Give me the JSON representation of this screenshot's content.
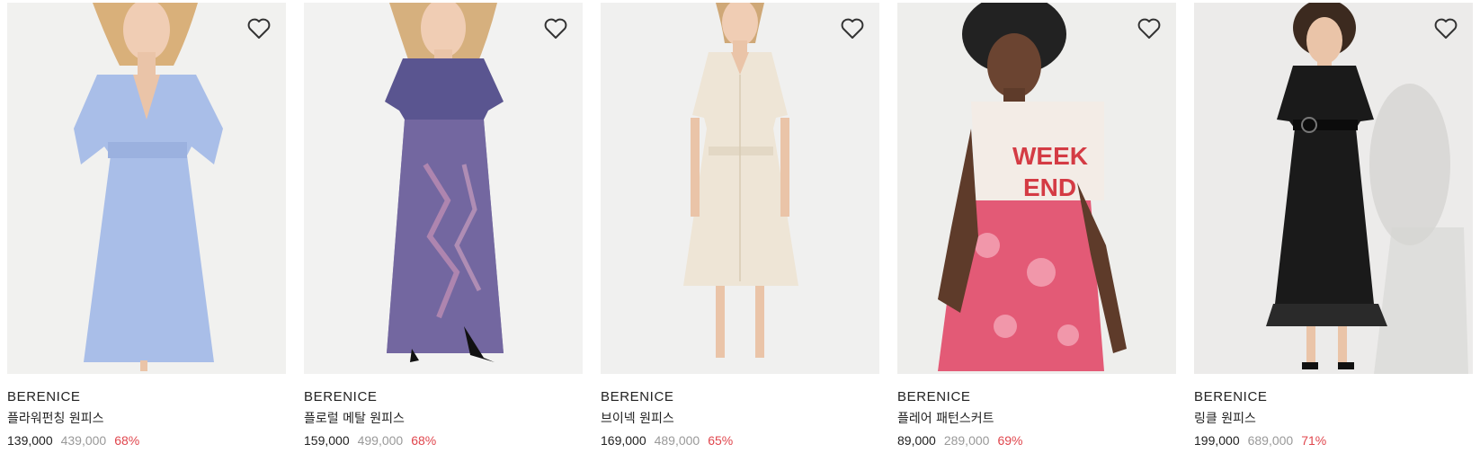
{
  "colors": {
    "discount": "#e0464d",
    "original_price": "#999999",
    "price": "#222222"
  },
  "products": [
    {
      "brand": "BERENICE",
      "name": "플라워펀칭 원피스",
      "price": "139,000",
      "original_price": "439,000",
      "discount": "68%",
      "wishlist_icon": "heart-outline-icon",
      "image": "light-blue-eyelet-dress-model"
    },
    {
      "brand": "BERENICE",
      "name": "플로럴 메탈 원피스",
      "price": "159,000",
      "original_price": "499,000",
      "discount": "68%",
      "wishlist_icon": "heart-outline-icon",
      "image": "purple-floral-maxi-dress-model"
    },
    {
      "brand": "BERENICE",
      "name": "브이넥 원피스",
      "price": "169,000",
      "original_price": "489,000",
      "discount": "65%",
      "wishlist_icon": "heart-outline-icon",
      "image": "cream-button-dress-model"
    },
    {
      "brand": "BERENICE",
      "name": "플레어 패턴스커트",
      "price": "89,000",
      "original_price": "289,000",
      "discount": "69%",
      "wishlist_icon": "heart-outline-icon",
      "image": "pink-pattern-skirt-model"
    },
    {
      "brand": "BERENICE",
      "name": "링클 원피스",
      "price": "199,000",
      "original_price": "689,000",
      "discount": "71%",
      "wishlist_icon": "heart-outline-icon",
      "image": "black-lace-dress-model"
    }
  ]
}
